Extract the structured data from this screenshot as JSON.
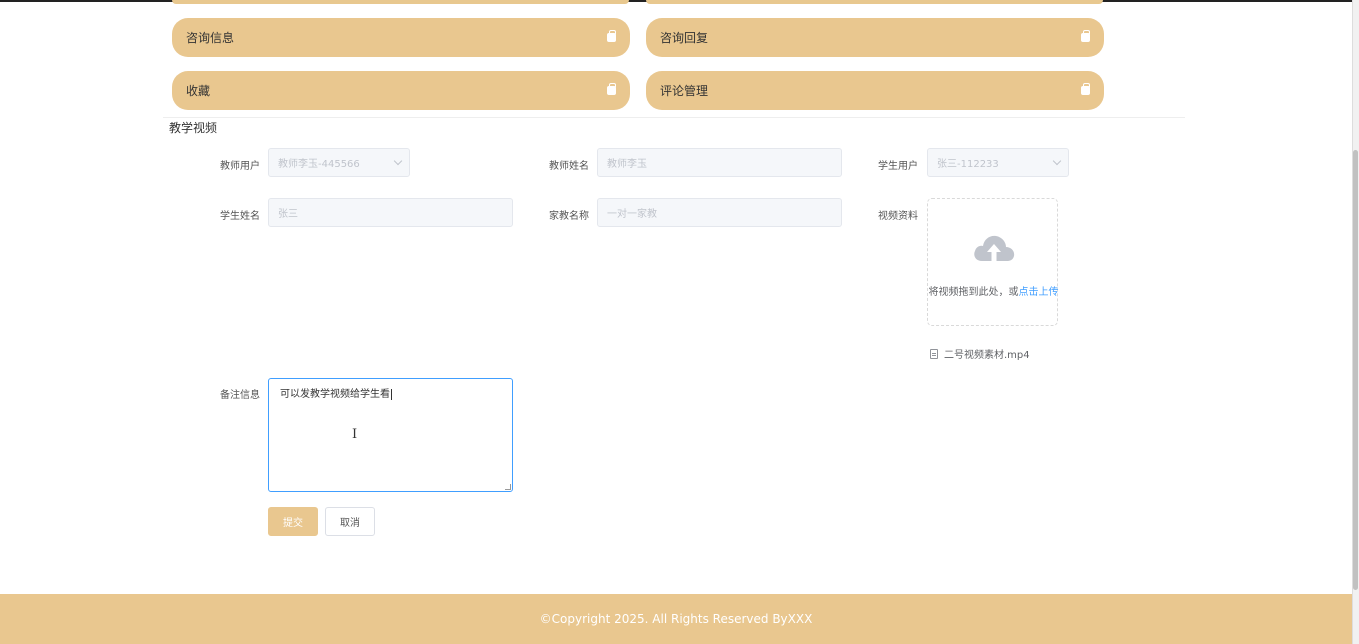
{
  "menu": {
    "cards": [
      {
        "label": "咨询信息",
        "icon": "bag-icon"
      },
      {
        "label": "咨询回复",
        "icon": "bag-icon"
      },
      {
        "label": "收藏",
        "icon": "bag-icon"
      },
      {
        "label": "评论管理",
        "icon": "bag-icon"
      }
    ]
  },
  "section": {
    "title": "教学视频"
  },
  "form": {
    "teacher_user": {
      "label": "教师用户",
      "value": "教师李玉-445566"
    },
    "teacher_name": {
      "label": "教师姓名",
      "value": "教师李玉"
    },
    "student_user": {
      "label": "学生用户",
      "value": "张三-112233"
    },
    "student_name": {
      "label": "学生姓名",
      "value": "张三"
    },
    "tutor_name": {
      "label": "家教名称",
      "value": "一对一家教"
    },
    "video": {
      "label": "视频资料",
      "upload_hint": "将视频拖到此处，或",
      "upload_link": "点击上传",
      "file_name": "二号视频素材.mp4"
    },
    "remark": {
      "label": "备注信息",
      "value": "可以发教学视频给学生看"
    },
    "submit_label": "提交",
    "cancel_label": "取消"
  },
  "footer": {
    "text": "©Copyright 2025. All Rights Reserved ByXXX"
  },
  "colors": {
    "accent": "#e9c78f",
    "link": "#409eff",
    "focus_border": "#409eff"
  }
}
